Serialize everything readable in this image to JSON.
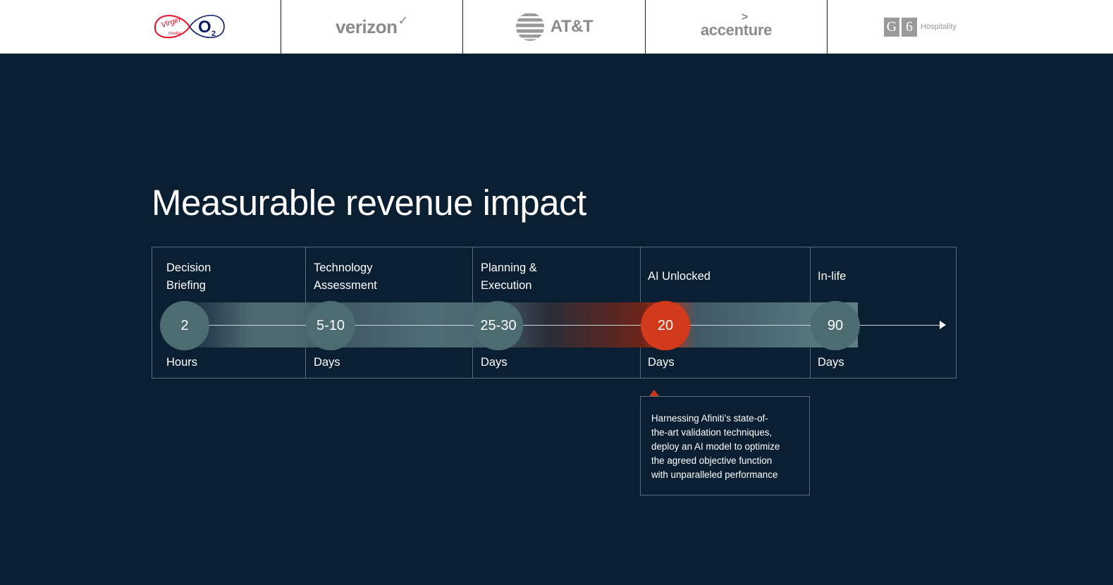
{
  "logos": [
    {
      "name": "Virgin Media O2",
      "text_primary": "Virgin",
      "text_secondary": "media",
      "text_o2": "O",
      "text_o2_sub": "2"
    },
    {
      "name": "Verizon",
      "text": "verizon",
      "mark": "✓"
    },
    {
      "name": "AT&T",
      "text": "AT&T"
    },
    {
      "name": "Accenture",
      "text": "accenture",
      "mark": ">"
    },
    {
      "name": "G6 Hospitality",
      "box1": "G",
      "box2": "6",
      "text": "Hospitality"
    }
  ],
  "heading": "Measurable revenue impact",
  "timeline": {
    "stages": [
      {
        "label_line1": "Decision",
        "label_line2": "Briefing",
        "value": "2",
        "unit": "Hours",
        "highlight": false
      },
      {
        "label_line1": "Technology",
        "label_line2": "Assessment",
        "value": "5-10",
        "unit": "Days",
        "highlight": false
      },
      {
        "label_line1": "Planning &",
        "label_line2": "Execution",
        "value": "25-30",
        "unit": "Days",
        "highlight": false
      },
      {
        "label_line1": "AI Unlocked",
        "label_line2": "",
        "value": "20",
        "unit": "Days",
        "highlight": true
      },
      {
        "label_line1": "In-life",
        "label_line2": "",
        "value": "90",
        "unit": "Days",
        "highlight": false
      }
    ]
  },
  "tooltip": {
    "lines": [
      "Harnessing Afiniti’s state-of-",
      "the-art validation techniques,",
      "deploy an AI model to optimize",
      "the agreed objective function",
      "with unparalleled performance"
    ]
  },
  "colors": {
    "background": "#0b1f33",
    "circle": "#4d6c72",
    "highlight": "#d23a1c",
    "border": "#5b6b7b",
    "logo_gray": "#8a8a8a",
    "virgin_red": "#e4142a",
    "o2_navy": "#0a1a6a"
  }
}
